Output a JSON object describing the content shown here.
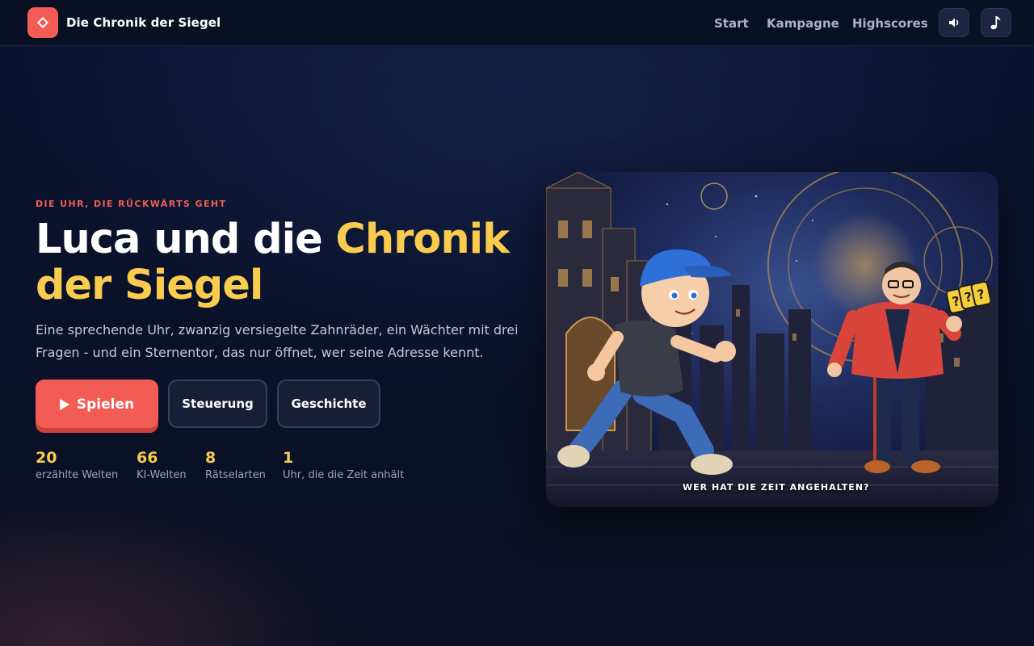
{
  "nav": {
    "brand": "Die Chronik der Siegel",
    "links": [
      "Start",
      "Kampagne",
      "Highscores"
    ],
    "buttons": [
      {
        "icon": "sound-icon",
        "glyph": "🔈"
      },
      {
        "icon": "music-icon",
        "glyph": "♪"
      }
    ]
  },
  "hero": {
    "eyebrow": "DIE UHR, DIE RÜCKWÄRTS GEHT",
    "title_part1": "Luca und die ",
    "title_accent": "Chronik der Siegel",
    "lead": "Eine sprechende Uhr, zwanzig versiegelte Zahnräder, ein Wächter mit drei Fragen - und ein Sternentor, das nur öffnet, wer seine Adresse kennt.",
    "play_label": "Spielen",
    "controls_label": "Steuerung",
    "story_label": "Geschichte",
    "stats": [
      {
        "value": "20",
        "label": "erzählte Welten"
      },
      {
        "value": "66",
        "label": "KI-Welten"
      },
      {
        "value": "8",
        "label": "Rätselarten"
      },
      {
        "value": "1",
        "label": "Uhr, die die Zeit anhält"
      }
    ],
    "image_caption": "WER HAT DIE ZEIT ANGEHALTEN?"
  },
  "colors": {
    "accent": "#f25c54",
    "highlight": "#f9cb4e",
    "background": "#0a1128"
  }
}
